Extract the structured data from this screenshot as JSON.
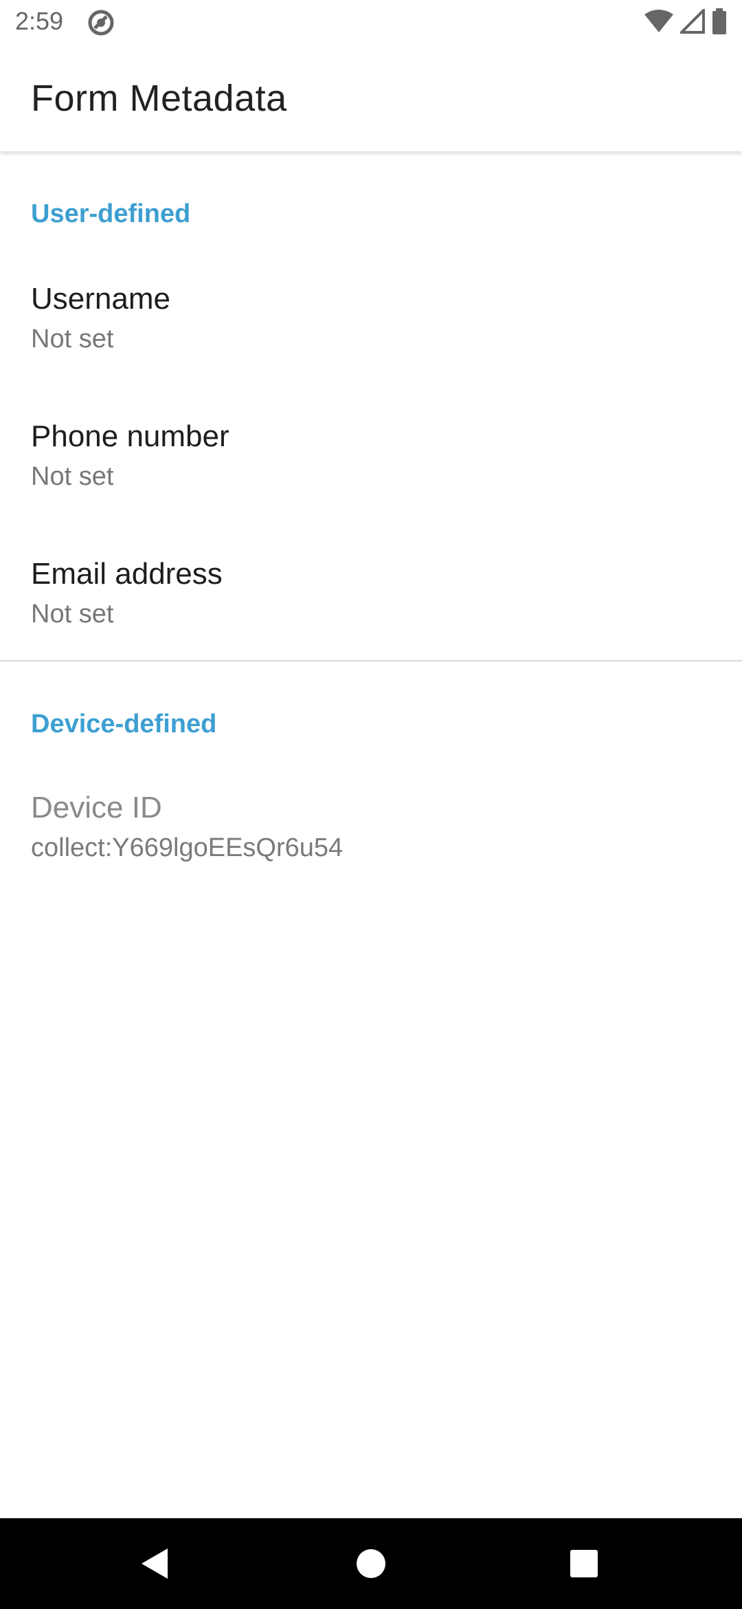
{
  "status_bar": {
    "time": "2:59",
    "icons": [
      "app-notification-icon",
      "wifi-icon",
      "cell-signal-icon",
      "battery-icon"
    ]
  },
  "app_bar": {
    "title": "Form Metadata"
  },
  "sections": {
    "user_defined": {
      "header": "User-defined",
      "items": [
        {
          "title": "Username",
          "summary": "Not set"
        },
        {
          "title": "Phone number",
          "summary": "Not set"
        },
        {
          "title": "Email address",
          "summary": "Not set"
        }
      ]
    },
    "device_defined": {
      "header": "Device-defined",
      "items": [
        {
          "title": "Device ID",
          "summary": "collect:Y669lgoEEsQr6u54"
        }
      ]
    }
  },
  "nav_bar": {
    "buttons": [
      "back-icon",
      "home-icon",
      "recents-icon"
    ]
  },
  "colors": {
    "accent": "#3d9fd1",
    "title_text": "#1d1d1d",
    "summary_text": "#777777",
    "nav_background": "#000000"
  }
}
